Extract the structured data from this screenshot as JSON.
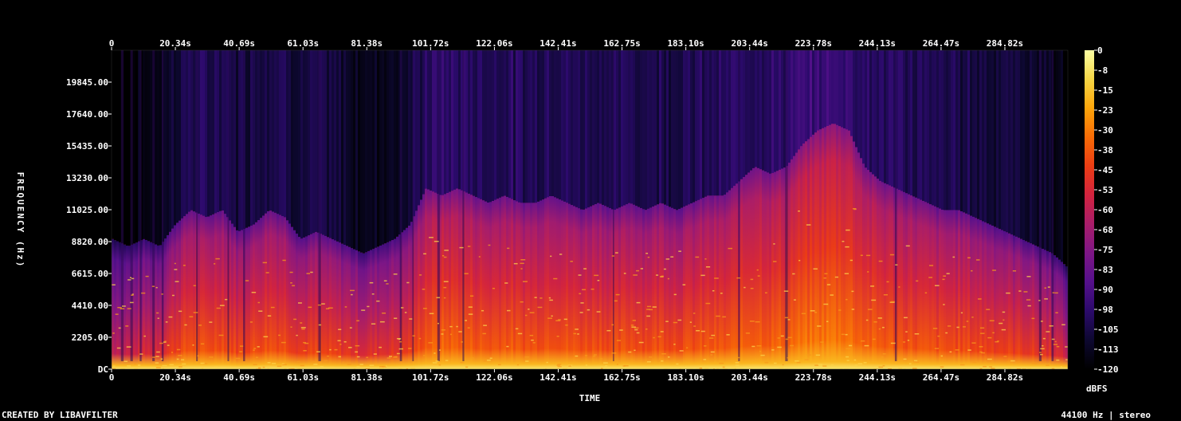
{
  "chart_data": {
    "type": "heatmap",
    "subtype": "spectrogram",
    "title": "",
    "xlabel": "TIME",
    "ylabel": "FREQUENCY (Hz)",
    "x_unit": "s",
    "x_ticks": [
      "0",
      "20.34s",
      "40.69s",
      "61.03s",
      "81.38s",
      "101.72s",
      "122.06s",
      "142.41s",
      "162.75s",
      "183.10s",
      "203.44s",
      "223.78s",
      "244.13s",
      "264.47s",
      "284.82s"
    ],
    "xlim": [
      0,
      305.2
    ],
    "y_ticks": [
      "DC",
      "2205.00",
      "4410.00",
      "6615.00",
      "8820.00",
      "11025.00",
      "13230.00",
      "15435.00",
      "17640.00",
      "19845.00"
    ],
    "ylim": [
      0,
      22050
    ],
    "colorbar": {
      "label": "dBFS",
      "ticks": [
        "0",
        "-8",
        "-15",
        "-23",
        "-30",
        "-38",
        "-45",
        "-53",
        "-60",
        "-68",
        "-75",
        "-83",
        "-90",
        "-98",
        "-105",
        "-113",
        "-120"
      ],
      "range": [
        -120,
        0
      ],
      "colormap": [
        "#000000",
        "#0d0830",
        "#2b0a6b",
        "#55108c",
        "#7d1686",
        "#a81d6a",
        "#d2233f",
        "#ec3d14",
        "#f86b06",
        "#fca50a",
        "#f6d645",
        "#fcffa4"
      ]
    },
    "energy_profile": {
      "description_note": "",
      "x_seconds": [
        0,
        5,
        10,
        15,
        20,
        25,
        30,
        35,
        40,
        45,
        50,
        55,
        60,
        65,
        70,
        75,
        80,
        85,
        90,
        95,
        100,
        105,
        110,
        115,
        120,
        125,
        130,
        135,
        140,
        145,
        150,
        155,
        160,
        165,
        170,
        175,
        180,
        185,
        190,
        195,
        200,
        205,
        210,
        215,
        220,
        225,
        230,
        235,
        240,
        245,
        250,
        255,
        260,
        265,
        270,
        275,
        280,
        285,
        290,
        295,
        300,
        305
      ],
      "upper_extent_hz": [
        9000,
        8500,
        9000,
        8500,
        10000,
        11000,
        10500,
        11000,
        9500,
        10000,
        11000,
        10500,
        9000,
        9500,
        9000,
        8500,
        8000,
        8500,
        9000,
        10000,
        12500,
        12000,
        12500,
        12000,
        11500,
        12000,
        11500,
        11500,
        12000,
        11500,
        11000,
        11500,
        11000,
        11500,
        11000,
        11500,
        11000,
        11500,
        12000,
        12000,
        13000,
        14000,
        13500,
        14000,
        15500,
        16500,
        17000,
        16500,
        14000,
        13000,
        12500,
        12000,
        11500,
        11000,
        11000,
        10500,
        10000,
        9500,
        9000,
        8500,
        8000,
        7000
      ],
      "level_db": [
        -80,
        -78,
        -75,
        -72,
        -65,
        -60,
        -62,
        -60,
        -64,
        -62,
        -60,
        -61,
        -66,
        -64,
        -66,
        -68,
        -72,
        -70,
        -69,
        -66,
        -58,
        -56,
        -57,
        -58,
        -60,
        -58,
        -60,
        -60,
        -58,
        -60,
        -61,
        -60,
        -62,
        -60,
        -62,
        -60,
        -62,
        -61,
        -60,
        -60,
        -58,
        -56,
        -57,
        -56,
        -54,
        -53,
        -52,
        -53,
        -57,
        -58,
        -59,
        -60,
        -61,
        -62,
        -62,
        -63,
        -64,
        -65,
        -66,
        -68,
        -70,
        -80
      ]
    }
  },
  "footer": {
    "left": "CREATED BY LIBAVFILTER",
    "right": "44100 Hz | stereo"
  }
}
